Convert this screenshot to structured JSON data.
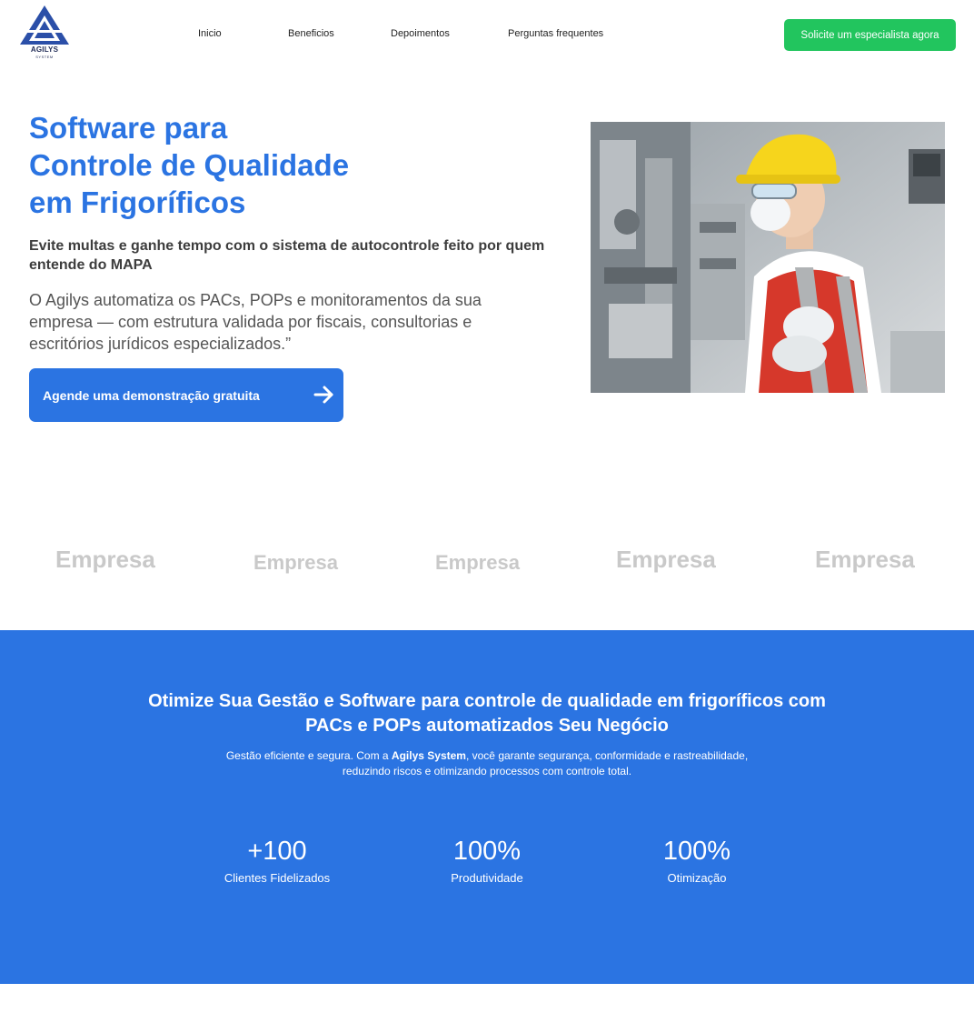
{
  "brand": {
    "name": "AGILYS",
    "sub": "SYSTEM"
  },
  "nav": {
    "items": [
      {
        "label": "Inicio"
      },
      {
        "label": "Beneficios"
      },
      {
        "label": "Depoimentos"
      },
      {
        "label": "Perguntas frequentes"
      }
    ],
    "cta_label": "Solicite um especialista agora"
  },
  "hero": {
    "title_lines": [
      "Software para",
      "Controle de Qualidade",
      "em Frigoríficos"
    ],
    "subtitle": "Evite multas e ganhe tempo com o sistema de autocontrole feito por quem entende do MAPA",
    "description": "O Agilys automatiza os PACs, POPs e monitoramentos da sua empresa — com estrutura validada por fiscais, consultorias e escritórios jurídicos especializados.”",
    "button_label": "Agende uma demonstração gratuita",
    "image_icon": "factory-worker-photo"
  },
  "companies": [
    "Empresa",
    "Empresa",
    "Empresa",
    "Empresa",
    "Empresa"
  ],
  "stats_section": {
    "title": "Otimize Sua Gestão e Software para controle de qualidade em frigoríficos com PACs e POPs automatizados Seu Negócio",
    "desc_prefix": "Gestão eficiente e segura. Com a ",
    "desc_bold": "Agilys System",
    "desc_suffix": ", você garante segurança, conformidade e rastreabilidade, reduzindo riscos e otimizando processos com controle total.",
    "stats": [
      {
        "value": "+100",
        "label": "Clientes Fidelizados"
      },
      {
        "value": "100%",
        "label": "Produtividade"
      },
      {
        "value": "100%",
        "label": "Otimização"
      }
    ]
  },
  "colors": {
    "primary": "#2b74e2",
    "cta_green": "#22c55e",
    "logo_navy": "#1f2a55"
  }
}
